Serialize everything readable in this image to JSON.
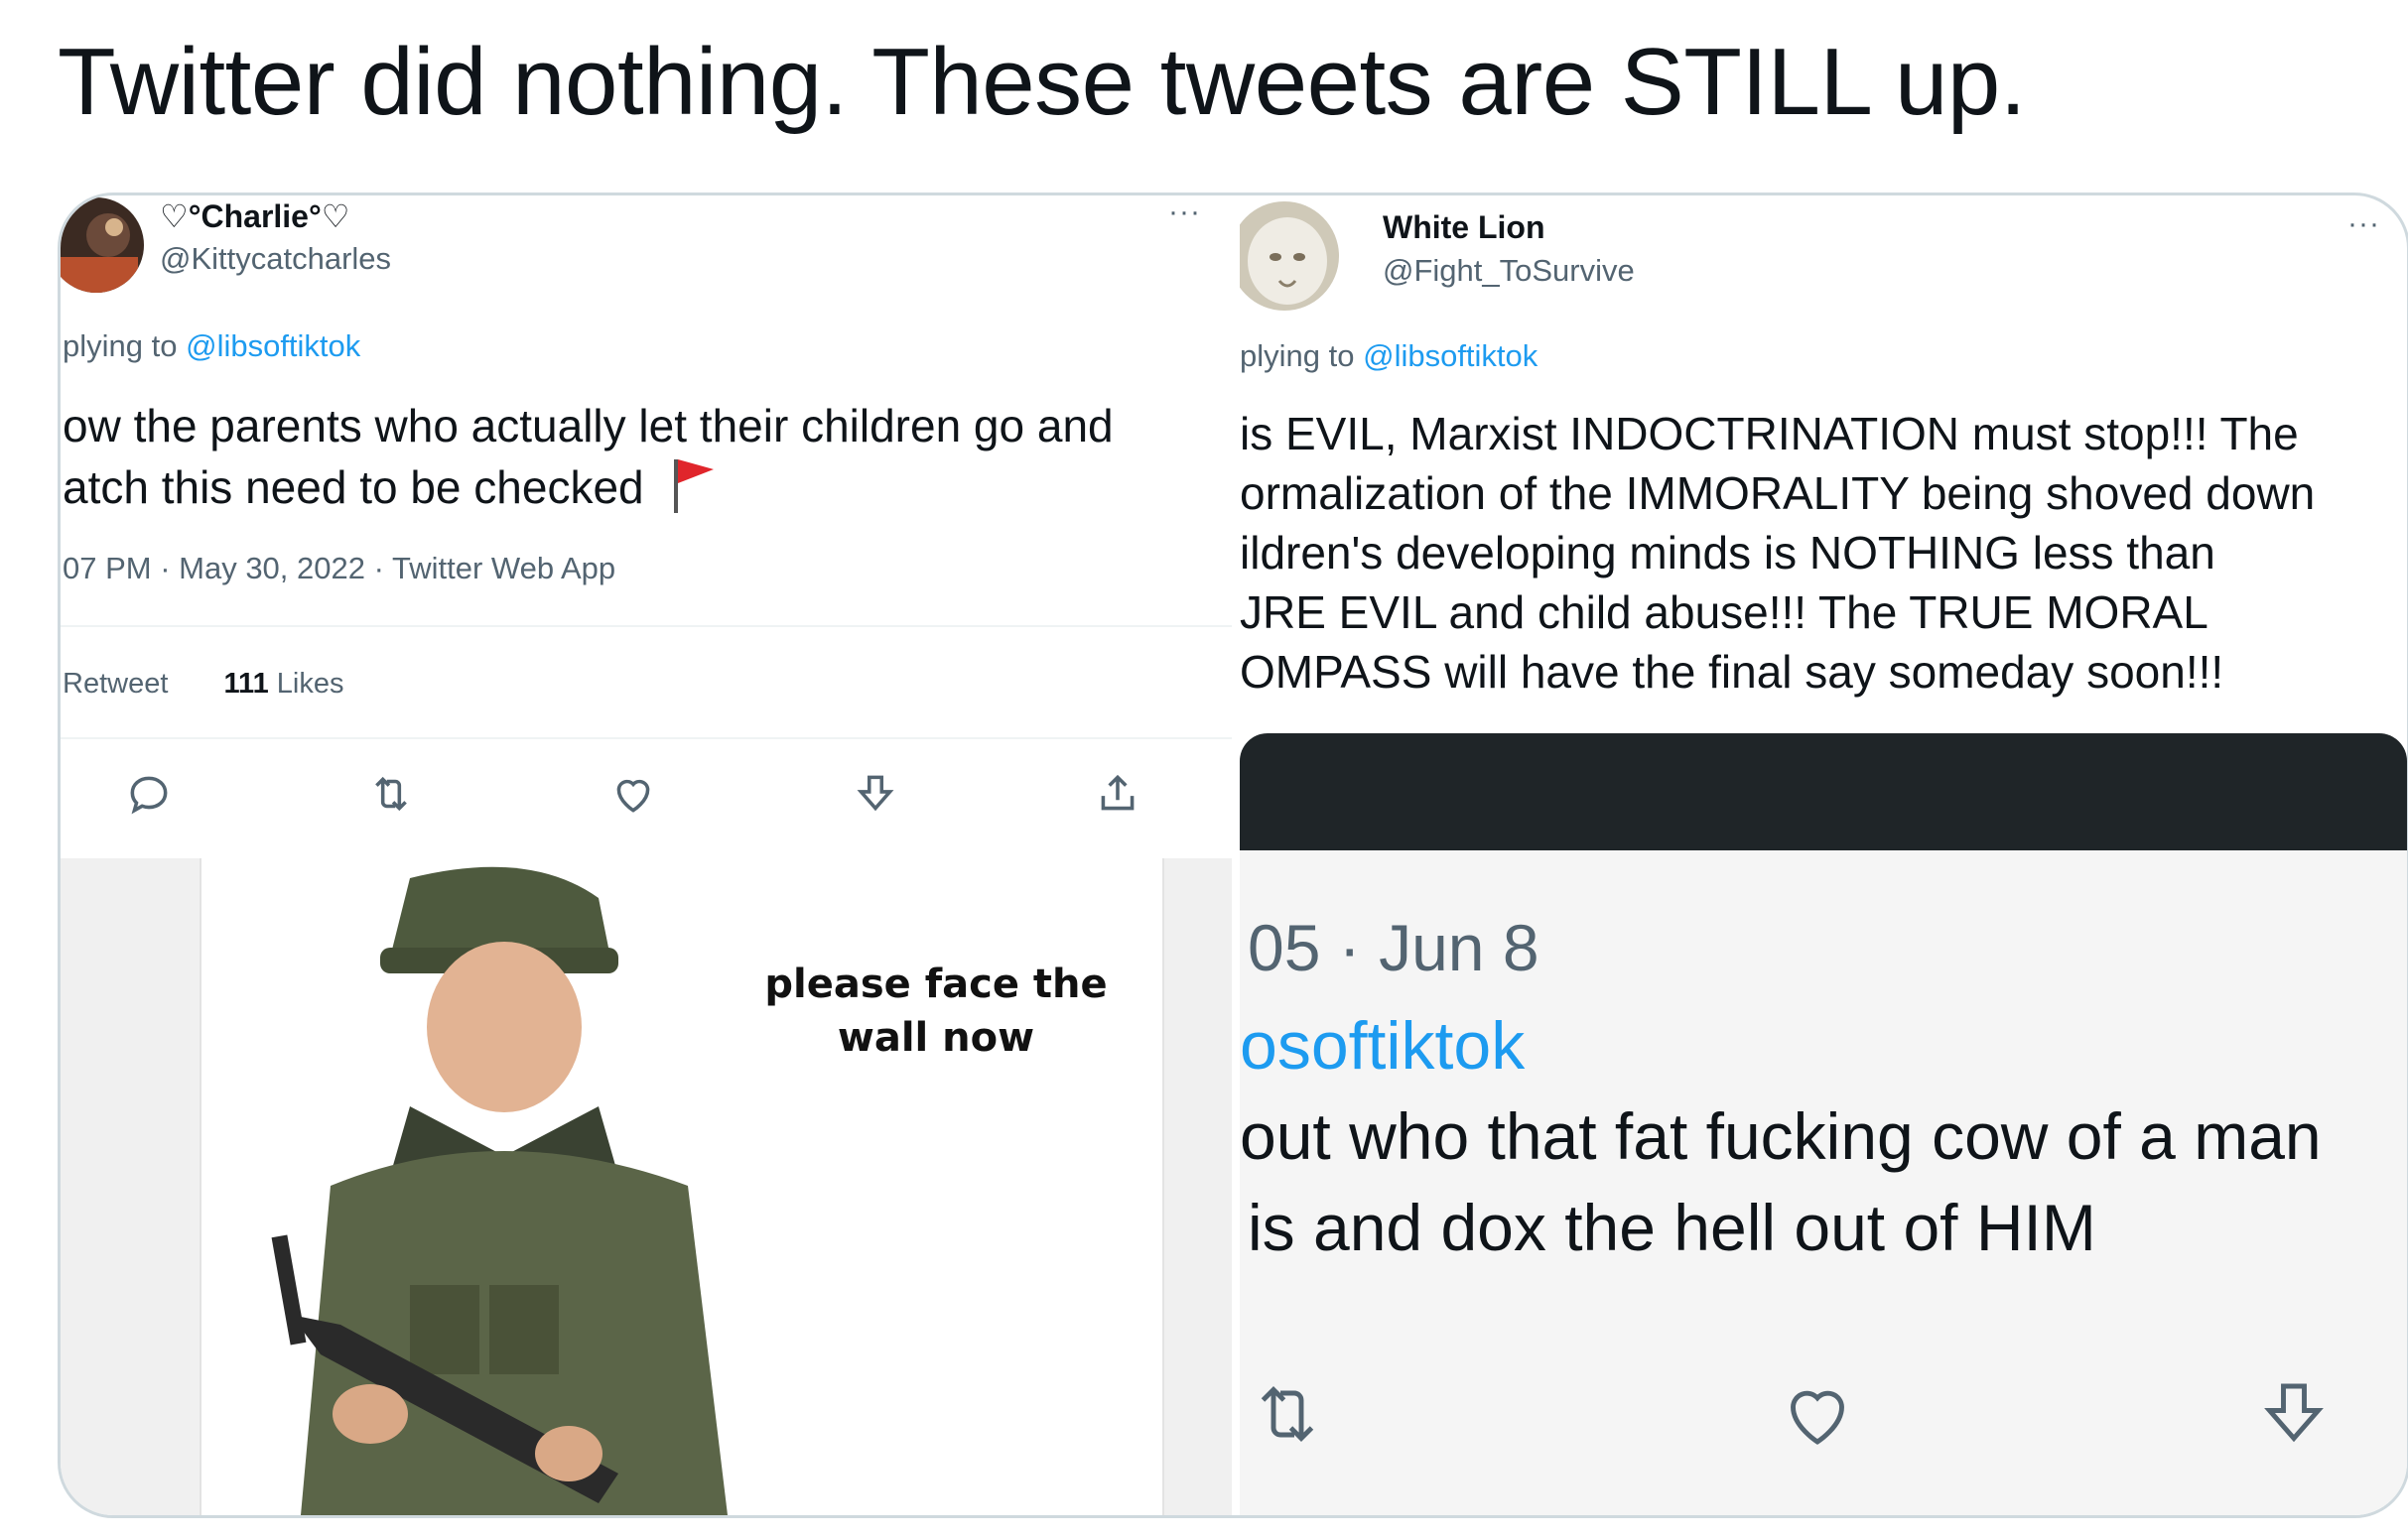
{
  "headline": "Twitter did nothing. These tweets are STILL up.",
  "left_tweet": {
    "display_name": "♡°Charlie°♡",
    "handle": "@Kittycatcharles",
    "more": "···",
    "reply_prefix": "plying to",
    "reply_to": "@libsoftiktok",
    "body_lines": [
      "ow the parents who actually let their children go and",
      "atch this need to be checked"
    ],
    "flag_emoji": "🚩",
    "meta": "07 PM · May 30, 2022 · Twitter Web App",
    "retweet_label": "Retweet",
    "likes_count": "111",
    "likes_label": "Likes",
    "actions": [
      "reply-icon",
      "retweet-icon",
      "like-icon",
      "bookmark-icon",
      "share-icon"
    ],
    "meme_caption_lines": [
      "please face the",
      "wall now"
    ]
  },
  "right_tweet": {
    "display_name": "White Lion",
    "handle": "@Fight_ToSurvive",
    "more": "···",
    "reply_prefix": "plying to",
    "reply_to": "@libsoftiktok",
    "body_lines": [
      "is EVIL, Marxist INDOCTRINATION must stop!!! The",
      "ormalization of the IMMORALITY being shoved down",
      "ildren's developing minds is NOTHING less than",
      "JRE EVIL and child abuse!!! The TRUE MORAL",
      "OMPASS will have the final say someday soon!!!"
    ],
    "embedded": {
      "time": "05 · Jun 8",
      "link": "osoftiktok",
      "body_lines": [
        "out who that fat fucking cow of a man",
        "is and dox the hell out of HIM"
      ],
      "actions": [
        "retweet-icon",
        "like-icon",
        "bookmark-icon"
      ]
    }
  },
  "colors": {
    "link": "#1d9bf0",
    "muted": "#536471",
    "text": "#0f1419",
    "border": "#cfd9de"
  }
}
